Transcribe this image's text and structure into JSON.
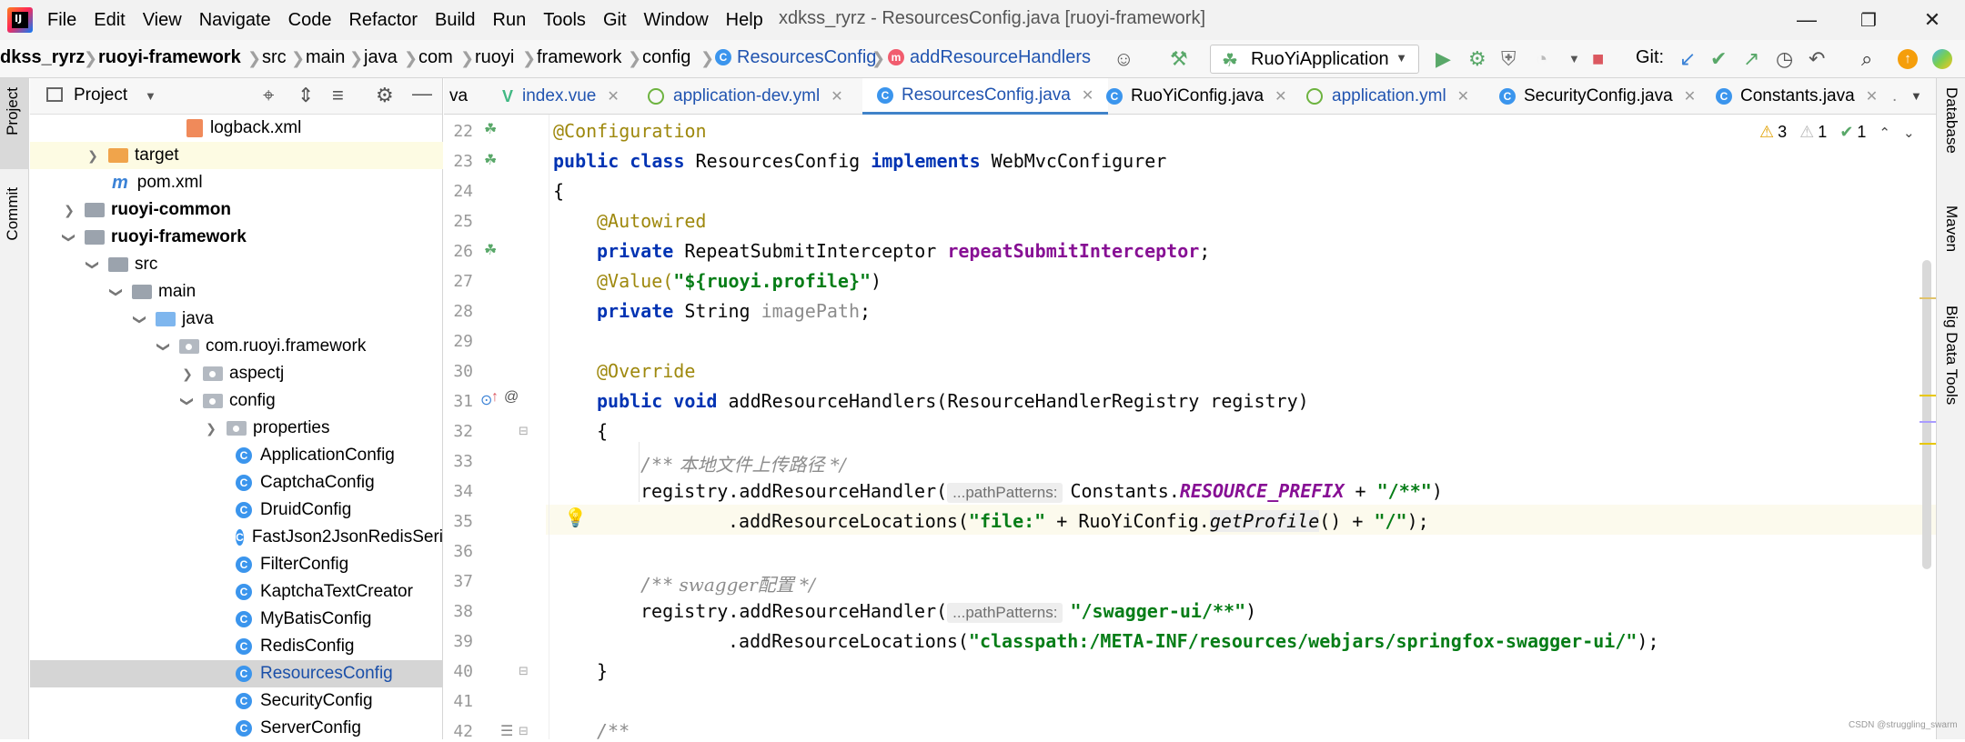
{
  "window": {
    "title": "xdkss_ryrz - ResourcesConfig.java [ruoyi-framework]",
    "logo_text": "IJ"
  },
  "menu": [
    "File",
    "Edit",
    "View",
    "Navigate",
    "Code",
    "Refactor",
    "Build",
    "Run",
    "Tools",
    "Git",
    "Window",
    "Help"
  ],
  "breadcrumb": {
    "project": "dkss_ryrz",
    "module": "ruoyi-framework",
    "p1": "src",
    "p2": "main",
    "p3": "java",
    "p4": "com",
    "p5": "ruoyi",
    "p6": "framework",
    "p7": "config",
    "class": "ResourcesConfig",
    "method": "addResourceHandlers"
  },
  "toolbar": {
    "run_config": "RuoYiApplication",
    "git_label": "Git:"
  },
  "left_strip": {
    "project": "Project",
    "commit": "Commit"
  },
  "right_strip": {
    "database": "Database",
    "maven": "Maven",
    "bigdata": "Big Data Tools"
  },
  "project_panel": {
    "title": "Project",
    "tree": [
      {
        "label": "logback.xml"
      },
      {
        "label": "target"
      },
      {
        "label": "pom.xml"
      },
      {
        "label": "ruoyi-common"
      },
      {
        "label": "ruoyi-framework"
      },
      {
        "label": "src"
      },
      {
        "label": "main"
      },
      {
        "label": "java"
      },
      {
        "label": "com.ruoyi.framework"
      },
      {
        "label": "aspectj"
      },
      {
        "label": "config"
      },
      {
        "label": "properties"
      },
      {
        "label": "ApplicationConfig"
      },
      {
        "label": "CaptchaConfig"
      },
      {
        "label": "DruidConfig"
      },
      {
        "label": "FastJson2JsonRedisSeri"
      },
      {
        "label": "FilterConfig"
      },
      {
        "label": "KaptchaTextCreator"
      },
      {
        "label": "MyBatisConfig"
      },
      {
        "label": "RedisConfig"
      },
      {
        "label": "ResourcesConfig"
      },
      {
        "label": "SecurityConfig"
      },
      {
        "label": "ServerConfig"
      }
    ]
  },
  "tabs": [
    {
      "label": "va"
    },
    {
      "label": "index.vue"
    },
    {
      "label": "application-dev.yml"
    },
    {
      "label": "ResourcesConfig.java"
    },
    {
      "label": "RuoYiConfig.java"
    },
    {
      "label": "application.yml"
    },
    {
      "label": "SecurityConfig.java"
    },
    {
      "label": "Constants.java"
    },
    {
      "label": "."
    }
  ],
  "inspections": {
    "warnings": "3",
    "weak": "1",
    "ok": "1"
  },
  "line_numbers": [
    "22",
    "23",
    "24",
    "25",
    "26",
    "27",
    "28",
    "29",
    "30",
    "31",
    "32",
    "33",
    "34",
    "35",
    "36",
    "37",
    "38",
    "39",
    "40",
    "41",
    "42"
  ],
  "code": {
    "l22": "@Configuration",
    "l23_kw": "public class",
    "l23_name": " ResourcesConfig ",
    "l23_impl": "implements",
    "l23_iface": " WebMvcConfigurer",
    "l24": "{",
    "l25": "@Autowired",
    "l26_kw": "private",
    "l26_type": " RepeatSubmitInterceptor ",
    "l26_field": "repeatSubmitInterceptor",
    "l26_end": ";",
    "l27_ann": "@Value(",
    "l27_str": "\"${ruoyi.profile}\"",
    "l27_end": ")",
    "l28_kw": "private",
    "l28_type": " String ",
    "l28_field": "imagePath",
    "l28_end": ";",
    "l30": "@Override",
    "l31_kw": "public void",
    "l31_rest": " addResourceHandlers(ResourceHandlerRegistry registry)",
    "l32": "{",
    "l33_a": "/**",
    "l33_b": " 本地文件上传路径 */",
    "l34_a": "registry.addResourceHandler(",
    "l34_hint": "...pathPatterns:",
    "l34_b": "Constants.",
    "l34_const": "RESOURCE_PREFIX",
    "l34_c": " + ",
    "l34_str": "\"/**\"",
    "l34_d": ")",
    "l35_a": ".addResourceLocations(",
    "l35_str1": "\"file:\"",
    "l35_b": " + RuoYiConfig.",
    "l35_m": "getProfile",
    "l35_c": "() + ",
    "l35_str2": "\"/\"",
    "l35_d": ");",
    "l37_a": "/**",
    "l37_b": " swagger配置 */",
    "l38_a": "registry.addResourceHandler(",
    "l38_hint": "...pathPatterns:",
    "l38_str": "\"/swagger-ui/**\"",
    "l38_d": ")",
    "l39_a": ".addResourceLocations(",
    "l39_str": "\"classpath:/META-INF/resources/webjars/springfox-swagger-ui/\"",
    "l39_d": ");",
    "l40": "}",
    "l42": "/**"
  },
  "watermark": "CSDN @struggling_swarm"
}
